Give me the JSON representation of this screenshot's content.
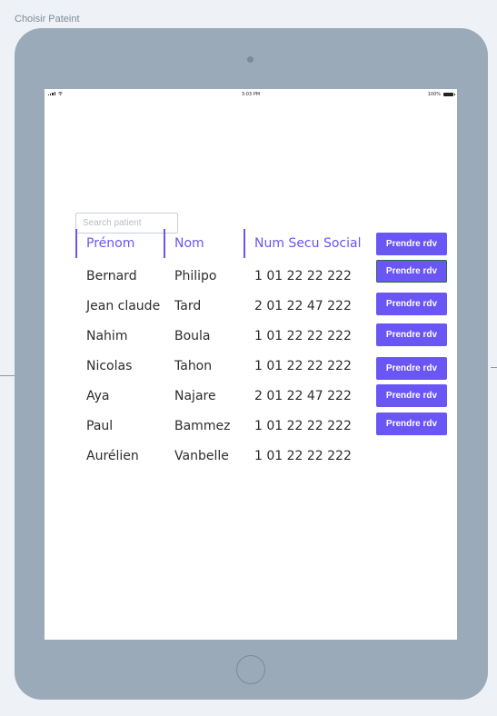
{
  "artboard": {
    "title": "Choisir Pateint"
  },
  "status_bar": {
    "time": "3:03 PM",
    "battery": "100%"
  },
  "search": {
    "placeholder": "Search patient",
    "value": ""
  },
  "table": {
    "headers": [
      "Prénom",
      "Nom",
      "Num Secu Social"
    ],
    "rows": [
      {
        "prenom": "Bernard",
        "nom": "Philipo",
        "num": "1 01 22 22 222",
        "action": "Prendre rdv"
      },
      {
        "prenom": "Jean claude",
        "nom": "Tard",
        "num": "2 01 22 47 222",
        "action": "Prendre rdv",
        "focused": true
      },
      {
        "prenom": "Nahim",
        "nom": "Boula",
        "num": "1 01 22 22 222",
        "action": "Prendre rdv"
      },
      {
        "prenom": "Nicolas",
        "nom": "Tahon",
        "num": "1 01 22 22 222",
        "action": "Prendre rdv"
      },
      {
        "prenom": "Aya",
        "nom": "Najare",
        "num": "2 01 22 47 222",
        "action": "Prendre rdv"
      },
      {
        "prenom": "Paul",
        "nom": "Bammez",
        "num": "1 01 22 22 222",
        "action": "Prendre rdv"
      },
      {
        "prenom": "Aurélien",
        "nom": "Vanbelle",
        "num": "1 01 22 22 222",
        "action": "Prendre rdv"
      }
    ]
  },
  "colors": {
    "accent": "#6a55f5",
    "device": "#9aaab9",
    "canvas": "#eef2f6",
    "focus_outline": "#2e6a52"
  },
  "icons": [
    "signal-icon",
    "wifi-icon",
    "battery-icon",
    "camera-icon",
    "home-button"
  ]
}
